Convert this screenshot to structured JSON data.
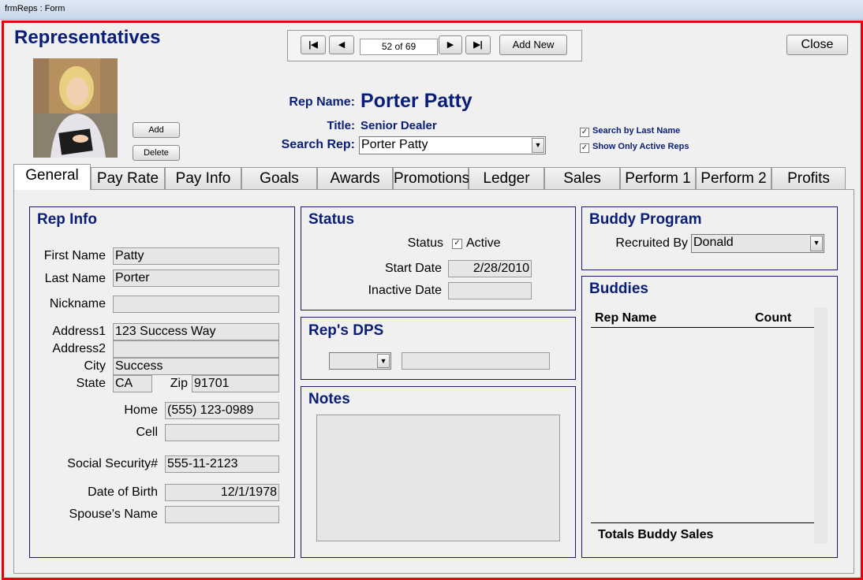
{
  "window": {
    "title": "frmReps : Form"
  },
  "header": {
    "title": "Representatives"
  },
  "nav": {
    "record": "52 of 69",
    "add_new": "Add New",
    "first": "|◀",
    "prev": "◀",
    "next": "▶",
    "last": "▶|"
  },
  "close_label": "Close",
  "photo": {
    "add": "Add",
    "delete": "Delete"
  },
  "rep": {
    "name_label": "Rep Name:",
    "name": "Porter Patty",
    "title_label": "Title:",
    "title": "Senior Dealer",
    "search_label": "Search Rep:",
    "search_value": "Porter Patty"
  },
  "options": {
    "by_last_name": "Search by Last Name",
    "active_only": "Show Only Active Reps"
  },
  "tabs": [
    "General",
    "Pay Rate",
    "Pay Info",
    "Goals",
    "Awards",
    "Promotions",
    "Ledger",
    "Sales",
    "Perform 1",
    "Perform 2",
    "Profits"
  ],
  "rep_info": {
    "title": "Rep Info",
    "first_name_label": "First Name",
    "first_name": "Patty",
    "last_name_label": "Last Name",
    "last_name": "Porter",
    "nickname_label": "Nickname",
    "nickname": "",
    "address1_label": "Address1",
    "address1": "123 Success Way",
    "address2_label": "Address2",
    "address2": "",
    "city_label": "City",
    "city": "Success",
    "state_label": "State",
    "state": "CA",
    "zip_label": "Zip",
    "zip": "91701",
    "home_label": "Home",
    "home": "(555) 123-0989",
    "cell_label": "Cell",
    "cell": "",
    "ssn_label": "Social Security#",
    "ssn": "555-11-2123",
    "dob_label": "Date of Birth",
    "dob": "12/1/1978",
    "spouse_label": "Spouse's Name",
    "spouse": ""
  },
  "status": {
    "title": "Status",
    "status_label": "Status",
    "active_label": "Active",
    "start_label": "Start Date",
    "start": "2/28/2010",
    "inactive_label": "Inactive Date",
    "inactive": ""
  },
  "dps": {
    "title": "Rep's DPS"
  },
  "notes": {
    "title": "Notes"
  },
  "buddy": {
    "title": "Buddy Program",
    "recruited_label": "Recruited By",
    "recruited": "Donald"
  },
  "buddies": {
    "title": "Buddies",
    "col_name": "Rep Name",
    "col_count": "Count",
    "totals": "Totals Buddy Sales"
  }
}
